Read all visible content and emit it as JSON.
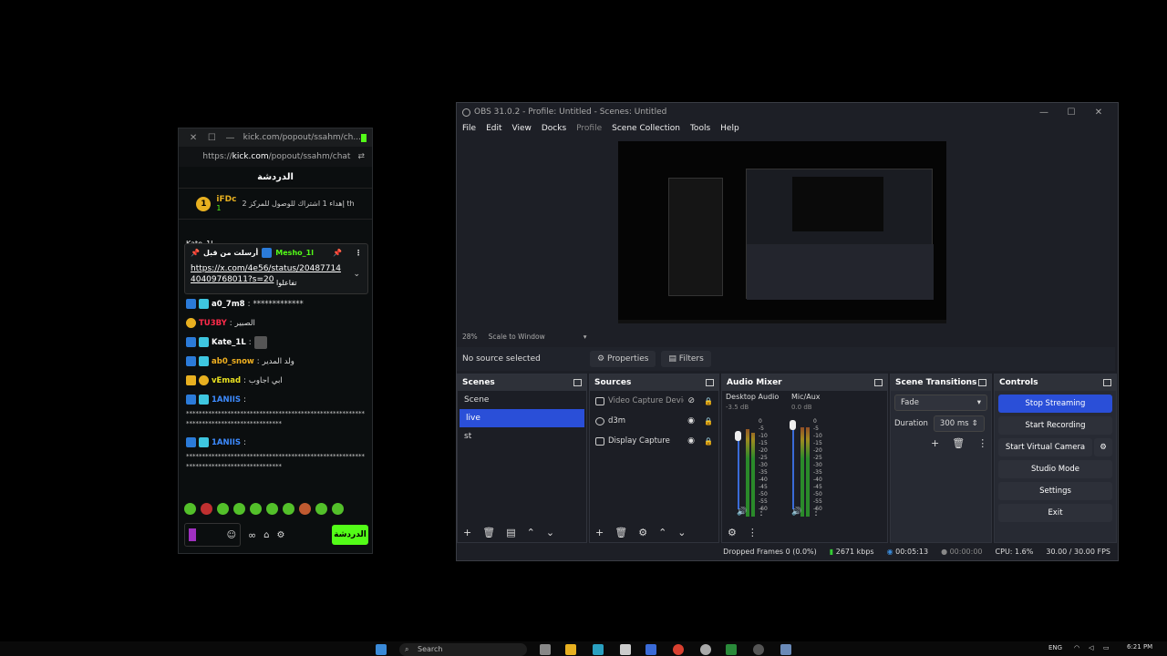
{
  "kick": {
    "tab_url": "kick.com/popout/ssahm/ch...",
    "url_prefix": "https://",
    "url_host": "kick.com",
    "url_path": "/popout/ssahm/chat",
    "chat_header": "الدردشة",
    "goal_user": "iFDc",
    "goal_count": "1",
    "goal_text": "إهداء 1 اشتراك للوصول للمركز 2 th",
    "goal_coin": "1",
    "pin_sender": "Mesho_1l",
    "pin_label": "أرسلت من قبل",
    "pin_link": "https://x.com/4e56/status/2048771440409768011?s=20",
    "pin_link_suffix": "تفاعلوا",
    "behind_user": "Kate_1L",
    "messages": [
      {
        "user": "a0_7m8",
        "text": "*************",
        "cls": "u-white"
      },
      {
        "user": "TU3BY",
        "text": "الصبير",
        "cls": "u-red"
      },
      {
        "user": "Kate_1L",
        "text": "",
        "cls": "u-white"
      },
      {
        "user": "ab0_snow",
        "text": "ولد المدير",
        "cls": "u-orange"
      },
      {
        "user": "vEmad",
        "text": "ابي اجاوب",
        "cls": "u-yellow"
      },
      {
        "user": "1ANIIS",
        "text": "",
        "cls": "u-blue"
      }
    ],
    "long_stars_1": "**************************************************************************************",
    "user_repeat": "1ANIIS",
    "long_stars_2": "**************************************************************************************",
    "send_button": "الدردشة"
  },
  "obs": {
    "title": "OBS 31.0.2 - Profile: Untitled - Scenes: Untitled",
    "menu": [
      "File",
      "Edit",
      "View",
      "Docks",
      "Profile",
      "Scene Collection",
      "Tools",
      "Help"
    ],
    "zoom": "28%",
    "scale_mode": "Scale to Window",
    "no_source": "No source selected",
    "properties": "Properties",
    "filters": "Filters",
    "docks": {
      "scenes": "Scenes",
      "sources": "Sources",
      "mixer": "Audio Mixer",
      "transitions": "Scene Transitions",
      "controls": "Controls"
    },
    "scenes": [
      "Scene",
      "live",
      "st"
    ],
    "selected_scene": "live",
    "sources": [
      {
        "name": "Video Capture Device",
        "icon": "camera-icon"
      },
      {
        "name": "d3m",
        "icon": "browser-icon"
      },
      {
        "name": "Display Capture",
        "icon": "monitor-icon"
      }
    ],
    "mixer": {
      "desktop_label": "Desktop Audio",
      "desktop_db": "-3.5 dB",
      "mic_label": "Mic/Aux",
      "mic_db": "0.0 dB",
      "ticks": [
        "0",
        "-5",
        "-10",
        "-15",
        "-20",
        "-25",
        "-30",
        "-35",
        "-40",
        "-45",
        "-50",
        "-55",
        "-60"
      ]
    },
    "transition": "Fade",
    "duration_label": "Duration",
    "duration_value": "300 ms",
    "controls": {
      "stop_streaming": "Stop Streaming",
      "start_recording": "Start Recording",
      "start_virtual_camera": "Start Virtual Camera",
      "studio_mode": "Studio Mode",
      "settings": "Settings",
      "exit": "Exit"
    },
    "status": {
      "dropped": "Dropped Frames 0 (0.0%)",
      "bitrate": "2671 kbps",
      "stream_time": "00:05:13",
      "rec_time": "00:00:00",
      "cpu": "CPU: 1.6%",
      "fps": "30.00 / 30.00 FPS"
    }
  },
  "taskbar": {
    "search": "Search",
    "lang": "ENG",
    "time": "6:21 PM"
  },
  "colors": {
    "kick_green": "#53fc18",
    "obs_accent": "#2a4fd8",
    "obs_bg": "#1d1f26"
  }
}
